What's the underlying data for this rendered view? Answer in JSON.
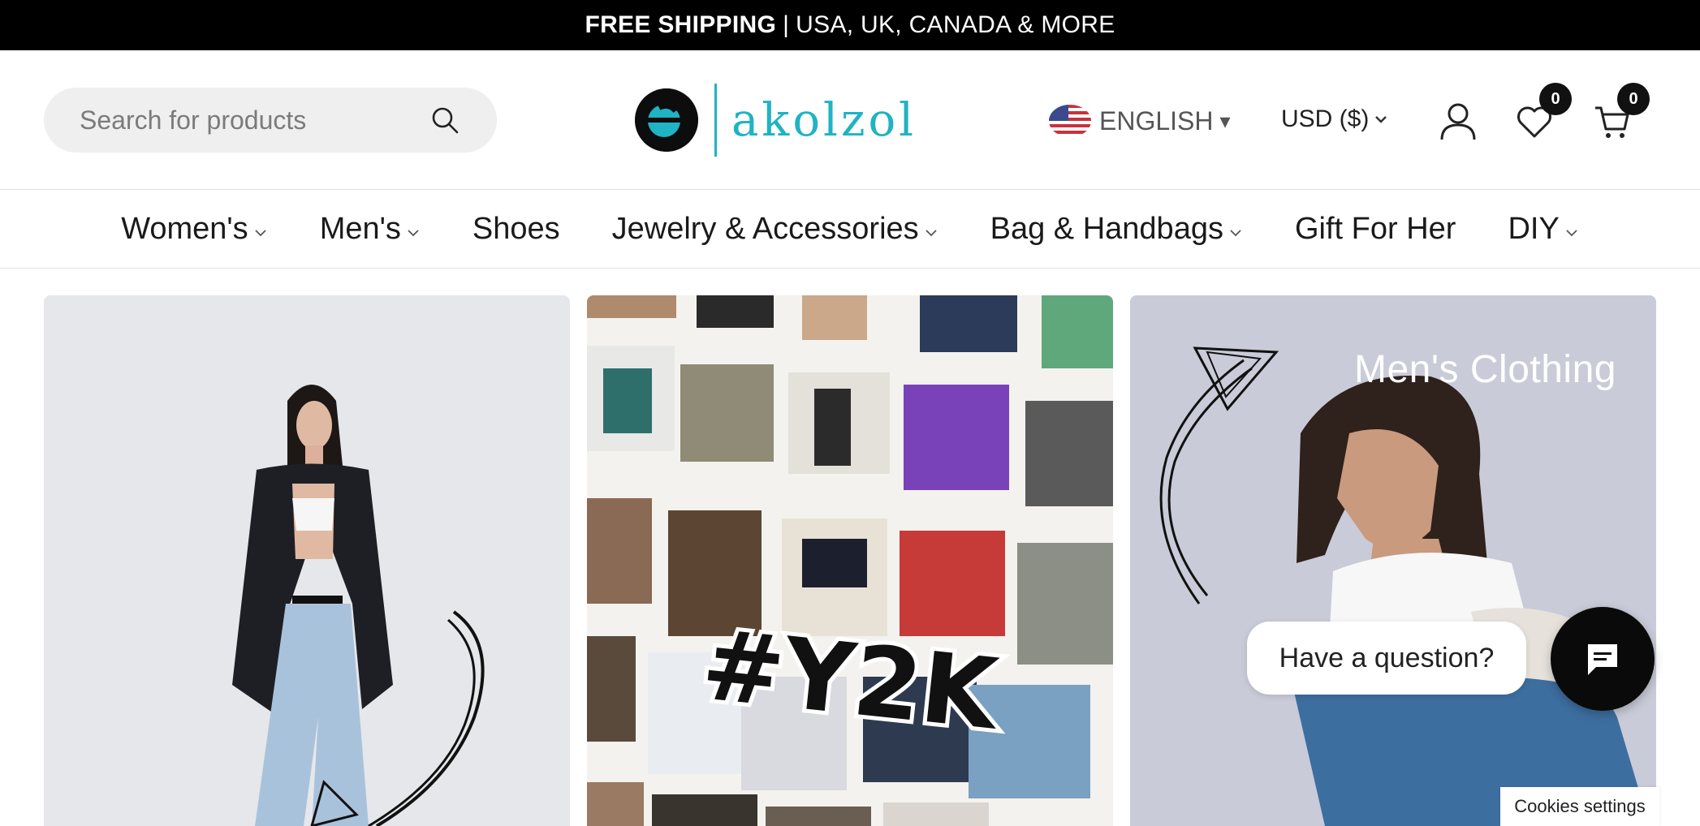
{
  "announcement": {
    "bold": "FREE SHIPPING",
    "separator": "|",
    "rest": "USA, UK, CANADA & MORE"
  },
  "search": {
    "placeholder": "Search for products"
  },
  "logo": {
    "text": "akolzol"
  },
  "language": {
    "label": "ENGLISH",
    "caret": "▾"
  },
  "currency": {
    "label": "USD ($)"
  },
  "wishlist": {
    "count": "0"
  },
  "cart": {
    "count": "0"
  },
  "nav": {
    "items": [
      {
        "label": "Women's",
        "dropdown": true
      },
      {
        "label": "Men's",
        "dropdown": true
      },
      {
        "label": "Shoes",
        "dropdown": false
      },
      {
        "label": "Jewelry & Accessories",
        "dropdown": true
      },
      {
        "label": "Bag & Handbags",
        "dropdown": true
      },
      {
        "label": "Gift For Her",
        "dropdown": false
      },
      {
        "label": "DIY",
        "dropdown": true
      }
    ]
  },
  "hero": {
    "collage_text": "#Y2K",
    "mens_label": "Men's Clothing"
  },
  "chat": {
    "prompt": "Have a question?"
  },
  "cookies": {
    "label": "Cookies settings"
  },
  "colors": {
    "accent": "#1fb3c4",
    "dark": "#000000",
    "search_bg": "#efefef"
  }
}
